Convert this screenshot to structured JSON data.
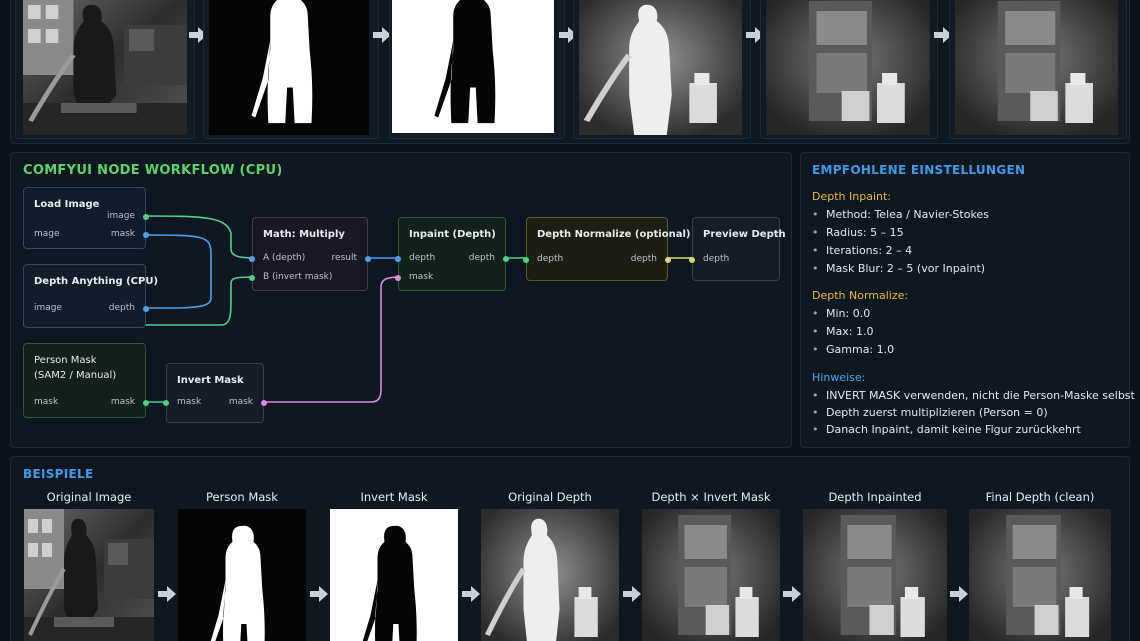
{
  "workflow": {
    "title": "COMFYUI NODE WORKFLOW (CPU)",
    "nodes": {
      "load_image": {
        "title": "Load Image",
        "out_image": "image",
        "in_image": "mage",
        "out_mask": "mask"
      },
      "depth_anything": {
        "title": "Depth Anything (CPU)",
        "in_image": "image",
        "out_depth": "depth"
      },
      "person_mask": {
        "title_line1": "Person Mask",
        "title_line2": "(SAM2 / Manual)",
        "in_mask": "mask",
        "out_mask": "mask"
      },
      "invert_mask": {
        "title": "Invert Mask",
        "in_mask": "mask",
        "out_mask": "mask"
      },
      "math_multiply": {
        "title": "Math: Multiply",
        "in_a": "A (depth)",
        "in_b": "B (invert mask)",
        "out_result": "result"
      },
      "inpaint_depth": {
        "title": "Inpaint (Depth)",
        "in_depth": "depth",
        "in_mask": "mask",
        "out_depth": "depth"
      },
      "depth_normalize": {
        "title": "Depth Normalize (optional)",
        "in_depth": "depth",
        "out_depth": "depth"
      },
      "preview_depth": {
        "title": "Preview Depth",
        "in_depth": "depth"
      }
    }
  },
  "settings": {
    "title": "EMPFOHLENE EINSTELLUNGEN",
    "bullet": "•",
    "inpaint": {
      "heading": "Depth Inpaint:",
      "items": [
        "Method: Telea / Navier-Stokes",
        "Radius: 5 – 15",
        "Iterations: 2 – 4",
        "Mask Blur: 2 – 5 (vor Inpaint)"
      ]
    },
    "normalize": {
      "heading": "Depth Normalize:",
      "items": [
        "Min: 0.0",
        "Max: 1.0",
        "Gamma: 1.0"
      ]
    },
    "hints": {
      "heading": "Hinweise:",
      "items": [
        "INVERT MASK verwenden, nicht die Person-Maske selbst",
        "Depth zuerst multiplizieren (Person = 0)",
        "Danach Inpaint, damit keine Figur zurückkehrt"
      ]
    }
  },
  "examples": {
    "title": "BEISPIELE",
    "labels": [
      "Original Image",
      "Person Mask",
      "Invert Mask",
      "Original Depth",
      "Depth × Invert Mask",
      "Depth Inpainted",
      "Final Depth (clean)"
    ]
  },
  "colors": {
    "green_link": "#4fd08a",
    "blue_link": "#4a9ff0",
    "pink_link": "#d88be6",
    "title_green": "#5ed36a",
    "title_blue": "#3d9bea",
    "heading_yellow": "#e8b93c"
  }
}
